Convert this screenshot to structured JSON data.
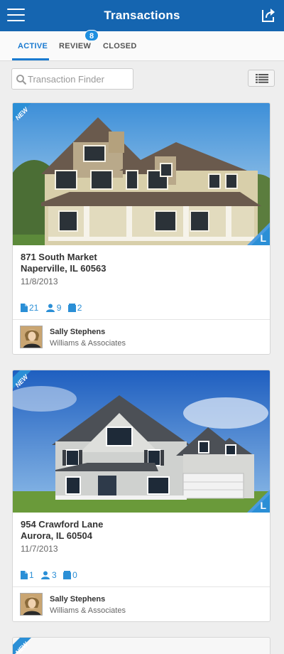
{
  "header": {
    "title": "Transactions"
  },
  "tabs": [
    {
      "label": "ACTIVE"
    },
    {
      "label": "REVIEW",
      "badge": "8"
    },
    {
      "label": "CLOSED"
    }
  ],
  "search": {
    "placeholder": "Transaction Finder",
    "value": ""
  },
  "colors": {
    "header": "#1565b0",
    "accent": "#1a7ad0",
    "ribbon": "#2b8fd6"
  },
  "transactions": [
    {
      "ribbon": "NEW",
      "corner": "L",
      "address_line1": "871 South Market",
      "address_line2": "Naperville, IL 60563",
      "date": "11/8/2013",
      "documents": "21",
      "people": "9",
      "folders": "2",
      "agent_name": "Sally Stephens",
      "agent_company": "Williams & Associates"
    },
    {
      "ribbon": "NEW",
      "corner": "L",
      "address_line1": "954 Crawford Lane",
      "address_line2": "Aurora, IL 60504",
      "date": "11/7/2013",
      "documents": "1",
      "people": "3",
      "folders": "0",
      "agent_name": "Sally Stephens",
      "agent_company": "Williams & Associates"
    },
    {
      "ribbon": "NEW"
    }
  ]
}
